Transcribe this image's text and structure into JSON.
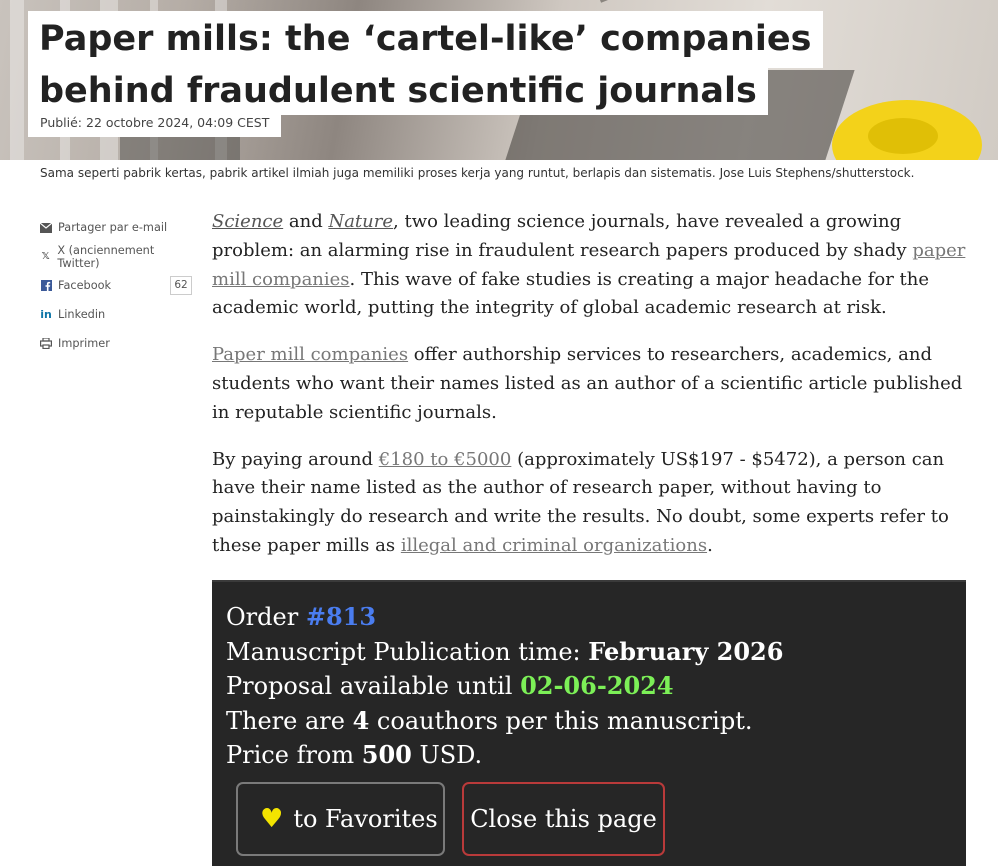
{
  "header": {
    "title_line1": "Paper mills: the ‘cartel-like’ companies",
    "title_line2": "behind fraudulent scientific journals",
    "published": "Publié: 22 octobre 2024, 04:09 CEST"
  },
  "caption": "Sama seperti pabrik kertas, pabrik artikel ilmiah juga memiliki proses kerja yang runtut, berlapis dan sistematis. Jose Luis Stephens/shutterstock.",
  "share": {
    "email": "Partager par e-mail",
    "twitter": "X (anciennement Twitter)",
    "facebook": "Facebook",
    "facebook_count": "62",
    "linkedin": "Linkedin",
    "print": "Imprimer"
  },
  "article": {
    "p1_link1": "Science",
    "p1_t1": " and ",
    "p1_link2": "Nature",
    "p1_t2": ", two leading science journals, have revealed a growing problem: an alarming rise in fraudulent research papers produced by shady ",
    "p1_link3": "paper mill companies",
    "p1_t3": ". This wave of fake studies is creating a major headache for the academic world, putting the integrity of global academic research at risk.",
    "p2_link": "Paper mill companies",
    "p2_t": " offer authorship services to researchers, academics, and students who want their names listed as an author of a scientific article published in reputable scientific journals.",
    "p3_t1": "By paying around ",
    "p3_link1": "€180 to €5000",
    "p3_t2": " (approximately US$197 - $5472), a person can have their name listed as the author of research paper, without having to painstakingly do research and write the results. No doubt, some experts refer to these paper mills as ",
    "p3_link2": "illegal and criminal organizations",
    "p3_t3": "."
  },
  "order_image": {
    "l1_a": "Order ",
    "l1_b": "#813",
    "l2_a": "Manuscript Publication time: ",
    "l2_b": "February 2026",
    "l3_a": "Proposal available until ",
    "l3_b": "02-06-2024",
    "l4_a": "There are ",
    "l4_b": "4",
    "l4_c": " coauthors per this manuscript.",
    "l5_a": "Price from ",
    "l5_b": "500",
    "l5_c": " USD.",
    "fav_label": "to Favorites",
    "close_label": "Close this page"
  }
}
